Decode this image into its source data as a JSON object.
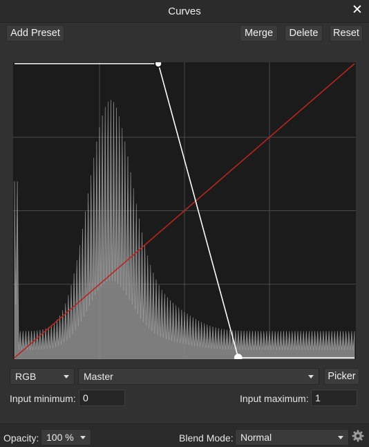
{
  "window": {
    "title": "Curves",
    "close_icon": "close-icon"
  },
  "toolbar": {
    "add_preset": "Add Preset",
    "merge": "Merge",
    "delete": "Delete",
    "reset": "Reset"
  },
  "curve": {
    "points": [
      {
        "input": 0.0,
        "output": 1.0
      },
      {
        "input": 0.423,
        "output": 1.0
      },
      {
        "input": 0.658,
        "output": 0.0
      },
      {
        "input": 1.0,
        "output": 0.0
      }
    ],
    "curve_color": "#ffffff",
    "identity_line_color": "#b8261f",
    "background_color": "#1b1b1b",
    "grid_color": "#4a4a4a",
    "grid_divisions": 4
  },
  "controls": {
    "color_space": "RGB",
    "channel": "Master",
    "picker": "Picker",
    "input_minimum_label": "Input minimum:",
    "input_minimum_value": "0",
    "input_maximum_label": "Input maximum:",
    "input_maximum_value": "1"
  },
  "footer": {
    "opacity_label": "Opacity:",
    "opacity_value": "100 %",
    "blend_mode_label": "Blend Mode:",
    "blend_mode_value": "Normal",
    "settings_icon": "gear-icon"
  }
}
